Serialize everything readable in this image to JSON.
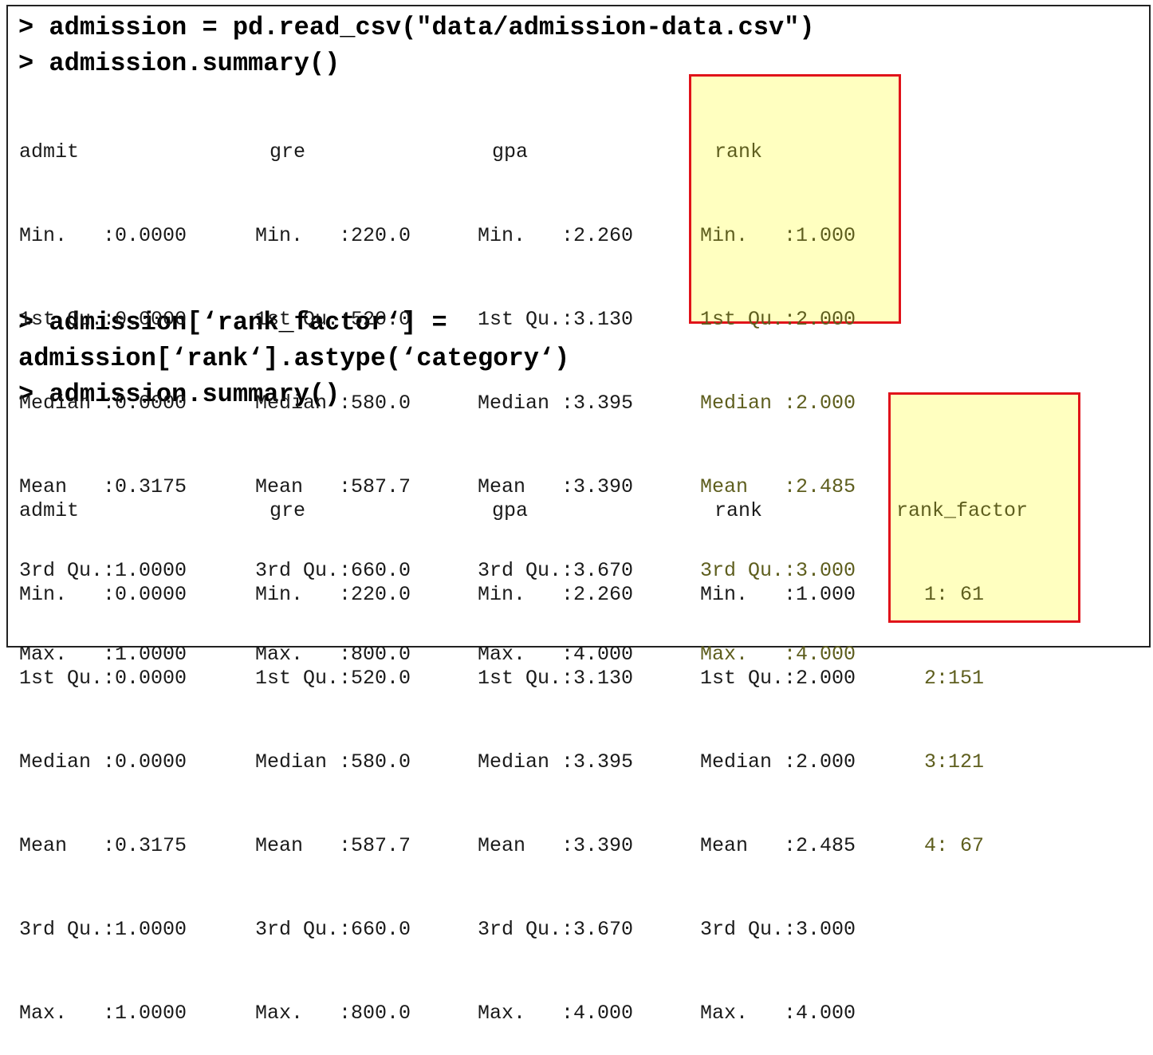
{
  "commands": {
    "read_csv": "> admission = pd.read_csv(\"data/admission-data.csv\")",
    "summary_1": "> admission.summary()",
    "astype_line1": "> admission[‘rank_factor‘] =",
    "astype_line2": "admission[‘rank‘].astype(‘category‘)",
    "summary_2": "> admission.summary()"
  },
  "summary_1": {
    "admit": {
      "header": "admit",
      "lines": [
        "Min.   :0.0000",
        "1st Qu.:0.0000",
        "Median :0.0000",
        "Mean   :0.3175",
        "3rd Qu.:1.0000",
        "Max.   :1.0000"
      ]
    },
    "gre": {
      "header": "gre",
      "lines": [
        "Min.   :220.0",
        "1st Qu.:520.0",
        "Median :580.0",
        "Mean   :587.7",
        "3rd Qu.:660.0",
        "Max.   :800.0"
      ]
    },
    "gpa": {
      "header": "gpa",
      "lines": [
        "Min.   :2.260",
        "1st Qu.:3.130",
        "Median :3.395",
        "Mean   :3.390",
        "3rd Qu.:3.670",
        "Max.   :4.000"
      ]
    },
    "rank": {
      "header": "rank",
      "lines": [
        "Min.   :1.000",
        "1st Qu.:2.000",
        "Median :2.000",
        "Mean   :2.485",
        "3rd Qu.:3.000",
        "Max.   :4.000"
      ]
    }
  },
  "summary_2": {
    "admit": {
      "header": "admit",
      "lines": [
        "Min.   :0.0000",
        "1st Qu.:0.0000",
        "Median :0.0000",
        "Mean   :0.3175",
        "3rd Qu.:1.0000",
        "Max.   :1.0000"
      ]
    },
    "gre": {
      "header": "gre",
      "lines": [
        "Min.   :220.0",
        "1st Qu.:520.0",
        "Median :580.0",
        "Mean   :587.7",
        "3rd Qu.:660.0",
        "Max.   :800.0"
      ]
    },
    "gpa": {
      "header": "gpa",
      "lines": [
        "Min.   :2.260",
        "1st Qu.:3.130",
        "Median :3.395",
        "Mean   :3.390",
        "3rd Qu.:3.670",
        "Max.   :4.000"
      ]
    },
    "rank": {
      "header": "rank",
      "lines": [
        "Min.   :1.000",
        "1st Qu.:2.000",
        "Median :2.000",
        "Mean   :2.485",
        "3rd Qu.:3.000",
        "Max.   :4.000"
      ]
    },
    "rank_factor": {
      "header": "rank_factor",
      "lines": [
        "1: 61",
        "2:151",
        "3:121",
        "4: 67"
      ]
    }
  },
  "colors": {
    "highlight_fill": "#ffffc0",
    "highlight_border": "#e0131a",
    "highlight_text": "#5e5e1e"
  }
}
